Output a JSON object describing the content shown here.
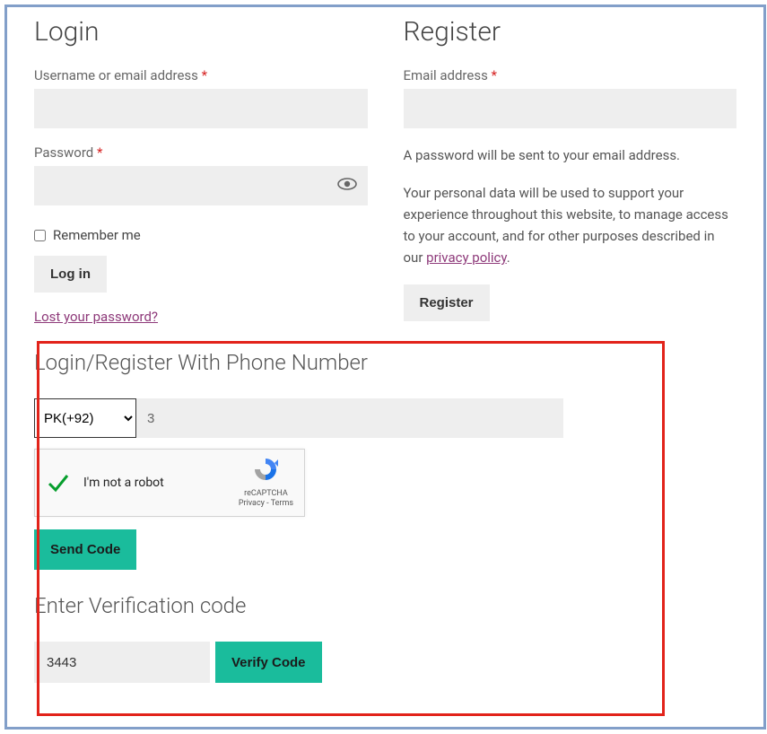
{
  "login": {
    "title": "Login",
    "username_label": "Username or email address ",
    "password_label": "Password ",
    "remember_label": "Remember me",
    "button": "Log in",
    "lost_link": "Lost your password?"
  },
  "register": {
    "title": "Register",
    "email_label": "Email address ",
    "pw_notice": "A password will be sent to your email address.",
    "privacy_pre": "Your personal data will be used to support your experience throughout this website, to manage access to your account, and for other purposes described in our ",
    "privacy_link": "privacy policy",
    "button": "Register"
  },
  "phone": {
    "title": "Login/Register With Phone Number",
    "country_code": "PK(+92)",
    "phone_value": "3",
    "recaptcha_label": "I'm not a robot",
    "recaptcha_brand": "reCAPTCHA",
    "recaptcha_sub": "Privacy - Terms",
    "send_button": "Send Code",
    "verify_title": "Enter Verification code",
    "verify_value": "3443",
    "verify_button": "Verify Code"
  }
}
